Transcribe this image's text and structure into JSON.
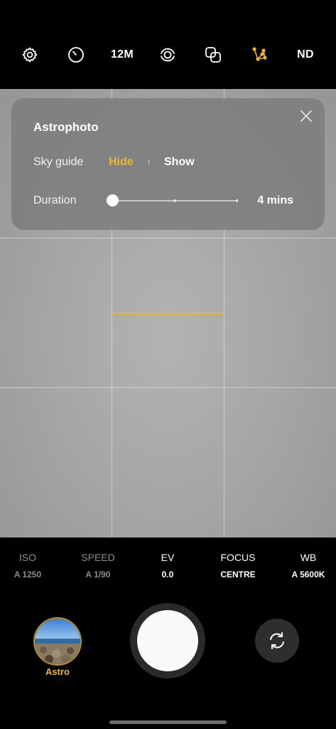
{
  "top_bar": {
    "icons": [
      "gear-icon",
      "timer-icon",
      "motion-photo-icon",
      "filter-icon",
      "astro-constellation-icon"
    ],
    "resolution_label": "12M",
    "nd_label": "ND",
    "active_color": "#e8b62f"
  },
  "panel": {
    "title": "Astrophoto",
    "sky_guide_label": "Sky guide",
    "sky_guide_options": [
      {
        "label": "Hide",
        "selected": true
      },
      {
        "label": "Show",
        "selected": false
      }
    ],
    "duration_label": "Duration",
    "duration_value": "4 mins",
    "duration_slider_fraction": 0.0
  },
  "pro_settings": [
    {
      "label": "ISO",
      "value": "A 1250",
      "active": false
    },
    {
      "label": "SPEED",
      "value": "A 1/90",
      "active": false
    },
    {
      "label": "EV",
      "value": "0.0",
      "active": true
    },
    {
      "label": "FOCUS",
      "value": "CENTRE",
      "active": true
    },
    {
      "label": "WB",
      "value": "A 5600K",
      "active": true
    }
  ],
  "bottom": {
    "thumbnail_label": "Astro",
    "accent_color": "#f0b92a"
  }
}
